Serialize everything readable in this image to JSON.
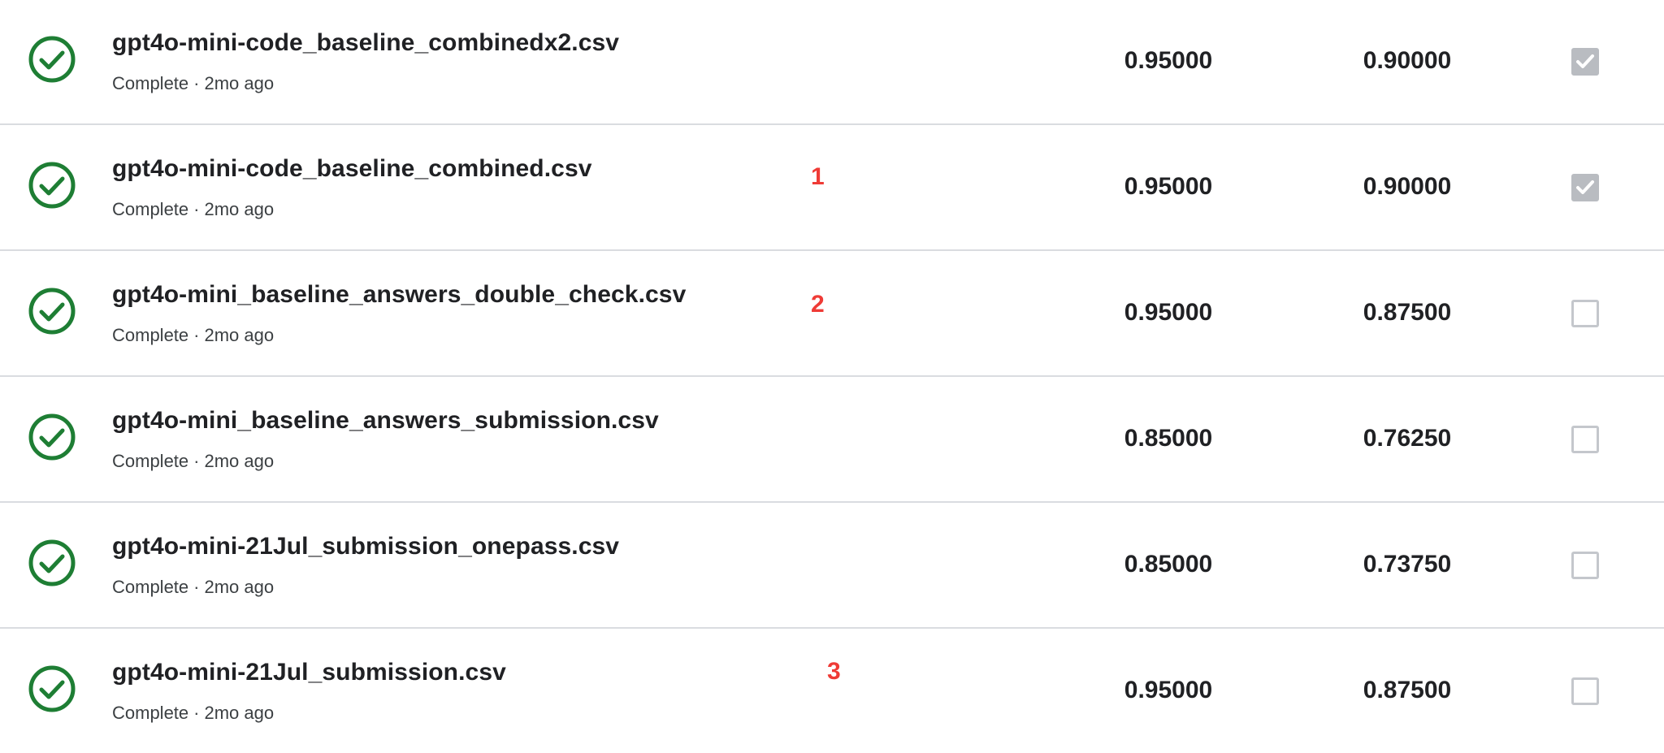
{
  "colors": {
    "complete_icon": "#1e7e34",
    "annotation": "#ef3b36",
    "checkbox_checked": "#b9bcc1",
    "checkbox_border": "#c4c7cc",
    "divider": "#dadce0"
  },
  "submissions": [
    {
      "file_name": "gpt4o-mini-code_baseline_combinedx2.csv",
      "status": "Complete",
      "separator": "·",
      "age": "2mo ago",
      "annotation": "",
      "public_score": "0.95000",
      "private_score": "0.90000",
      "selected": true,
      "status_icon": "check-circle-icon"
    },
    {
      "file_name": "gpt4o-mini-code_baseline_combined.csv",
      "status": "Complete",
      "separator": "·",
      "age": "2mo ago",
      "annotation": "1",
      "public_score": "0.95000",
      "private_score": "0.90000",
      "selected": true,
      "status_icon": "check-circle-icon"
    },
    {
      "file_name": "gpt4o-mini_baseline_answers_double_check.csv",
      "status": "Complete",
      "separator": "·",
      "age": "2mo ago",
      "annotation": "2",
      "public_score": "0.95000",
      "private_score": "0.87500",
      "selected": false,
      "status_icon": "check-circle-icon"
    },
    {
      "file_name": "gpt4o-mini_baseline_answers_submission.csv",
      "status": "Complete",
      "separator": "·",
      "age": "2mo ago",
      "annotation": "",
      "public_score": "0.85000",
      "private_score": "0.76250",
      "selected": false,
      "status_icon": "check-circle-icon"
    },
    {
      "file_name": "gpt4o-mini-21Jul_submission_onepass.csv",
      "status": "Complete",
      "separator": "·",
      "age": "2mo ago",
      "annotation": "",
      "public_score": "0.85000",
      "private_score": "0.73750",
      "selected": false,
      "status_icon": "check-circle-icon"
    },
    {
      "file_name": "gpt4o-mini-21Jul_submission.csv",
      "status": "Complete",
      "separator": "·",
      "age": "2mo ago",
      "annotation": "3",
      "public_score": "0.95000",
      "private_score": "0.87500",
      "selected": false,
      "status_icon": "check-circle-icon"
    }
  ]
}
